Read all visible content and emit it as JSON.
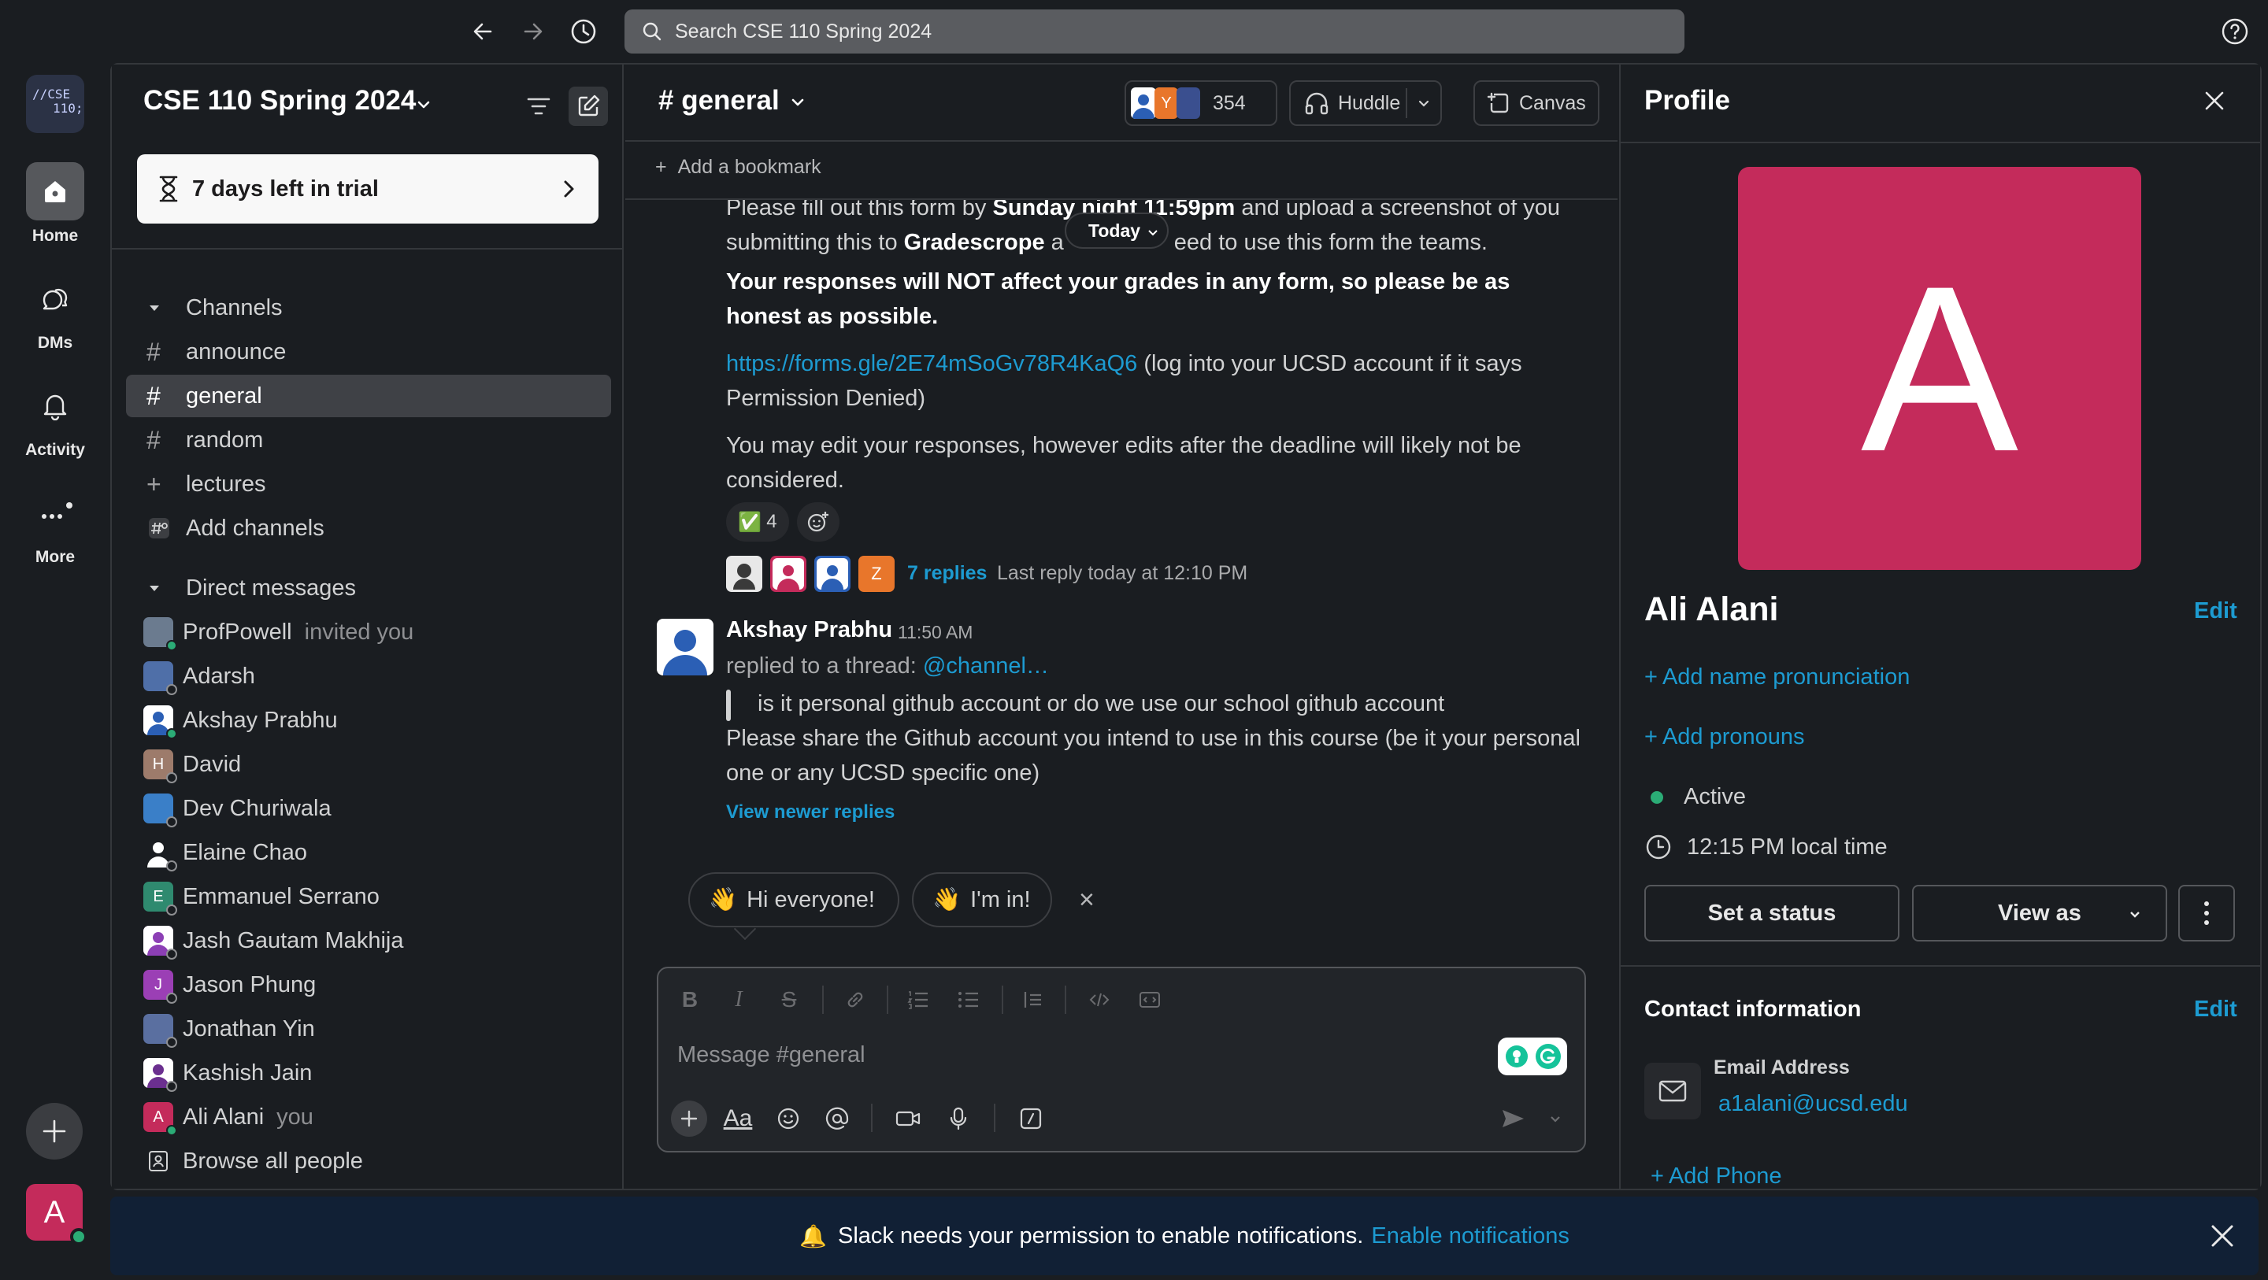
{
  "search": {
    "placeholder": "Search CSE 110 Spring 2024"
  },
  "rail": {
    "workspace_logo_line1": "//CSE",
    "workspace_logo_line2": "110;",
    "items": [
      {
        "label": "Home",
        "icon": "home-icon"
      },
      {
        "label": "DMs",
        "icon": "dms-icon"
      },
      {
        "label": "Activity",
        "icon": "bell-icon"
      },
      {
        "label": "More",
        "icon": "more-icon"
      }
    ],
    "avatar_initial": "A"
  },
  "sidebar": {
    "workspace_name": "CSE 110 Spring 2024",
    "trial_text": "7 days left in trial",
    "channels_header": "Channels",
    "channels": [
      {
        "label": "announce",
        "icon": "#"
      },
      {
        "label": "general",
        "icon": "#",
        "active": true
      },
      {
        "label": "random",
        "icon": "#"
      },
      {
        "label": "lectures",
        "icon": "+"
      },
      {
        "label": "Add channels",
        "icon": "add-channels-icon"
      }
    ],
    "dm_header": "Direct messages",
    "dms": [
      {
        "name": "ProfPowell",
        "suffix": "invited you"
      },
      {
        "name": "Adarsh",
        "suffix": ""
      },
      {
        "name": "Akshay Prabhu",
        "suffix": ""
      },
      {
        "name": "David",
        "suffix": "",
        "initial": "H"
      },
      {
        "name": "Dev Churiwala",
        "suffix": ""
      },
      {
        "name": "Elaine Chao",
        "suffix": ""
      },
      {
        "name": "Emmanuel Serrano",
        "suffix": "",
        "initial": "E"
      },
      {
        "name": "Jash Gautam Makhija",
        "suffix": ""
      },
      {
        "name": "Jason Phung",
        "suffix": "",
        "initial": "J"
      },
      {
        "name": "Jonathan Yin",
        "suffix": ""
      },
      {
        "name": "Kashish Jain",
        "suffix": ""
      },
      {
        "name": "Ali Alani",
        "suffix": "you",
        "initial": "A"
      }
    ],
    "browse_people": "Browse all people"
  },
  "channel": {
    "title": "# general",
    "member_count": "354",
    "huddle_label": "Huddle",
    "canvas_label": "Canvas",
    "add_bookmark": "Add a bookmark",
    "today_label": "Today"
  },
  "messages": {
    "m1_line1_a": "Please fill out this form by ",
    "m1_line1_b": "Sunday night 11:59pm",
    "m1_line1_c": " and upload a screenshot of you",
    "m1_line2_a": "submitting this to ",
    "m1_line2_b": "Gradescrope",
    "m1_line2_c": " a",
    "m1_line2_d": "eed to use this form the teams.",
    "m1_bold": "Your responses will NOT affect your grades in any form, so please be as honest as possible.",
    "m1_link": "https://forms.gle/2E74mSoGv78R4KaQ6",
    "m1_link_after": " (log into your UCSD account if it says Permission Denied)",
    "m1_edit": "You may edit your responses, however edits after the deadline will likely not be considered.",
    "reaction_emoji": "✅",
    "reaction_count": "4",
    "replies_count": "7 replies",
    "replies_last": "Last reply today at 12:10 PM",
    "m2_author": "Akshay Prabhu",
    "m2_time": "11:50 AM",
    "m2_replied": "replied to a thread: ",
    "m2_channel_link": "@channel…",
    "m2_quote": "is it personal github account or do we use our school github account",
    "m2_body": "Please share the Github account you intend to use in this course (be it your personal one or any UCSD specific one)",
    "view_newer": "View newer replies"
  },
  "suggestions": [
    {
      "emoji": "👋",
      "label": "Hi everyone!"
    },
    {
      "emoji": "👋",
      "label": "I'm in!"
    }
  ],
  "composer": {
    "placeholder": "Message #general"
  },
  "profile": {
    "title": "Profile",
    "avatar_initial": "A",
    "name": "Ali Alani",
    "edit_label": "Edit",
    "add_pronunciation": "Add name pronunciation",
    "add_pronouns": "Add pronouns",
    "status": "Active",
    "local_time": "12:15 PM local time",
    "set_status": "Set a status",
    "view_as": "View as",
    "contact_title": "Contact information",
    "contact_edit": "Edit",
    "email_label": "Email Address",
    "email": "a1alani@ucsd.edu",
    "add_phone": "Add Phone"
  },
  "notification": {
    "text": "Slack needs your permission to enable notifications.",
    "link": "Enable notifications"
  },
  "colors": {
    "accent_link": "#1d9bd1",
    "avatar_pink": "#c42b5b",
    "online_green": "#2bac76",
    "background": "#1a1d21"
  }
}
